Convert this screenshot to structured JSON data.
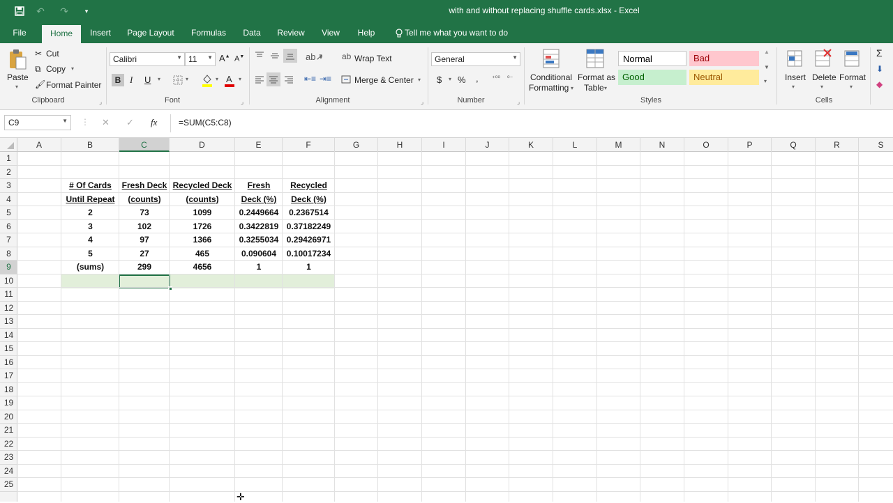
{
  "titlebar": {
    "title": "with and without replacing shuffle cards.xlsx  -  Excel",
    "save_icon": "save-icon",
    "undo_icon": "undo-icon",
    "redo_icon": "redo-icon",
    "customize_icon": "chevron-down-icon"
  },
  "tabs": [
    "File",
    "Home",
    "Insert",
    "Page Layout",
    "Formulas",
    "Data",
    "Review",
    "View",
    "Help"
  ],
  "tell_me": "Tell me what you want to do",
  "ribbon": {
    "clipboard": {
      "paste": "Paste",
      "cut": "Cut",
      "copy": "Copy",
      "format_painter": "Format Painter",
      "label": "Clipboard"
    },
    "font": {
      "name": "Calibri",
      "size": "11",
      "bold": "B",
      "italic": "I",
      "underline": "U",
      "label": "Font"
    },
    "alignment": {
      "wrap": "Wrap Text",
      "merge": "Merge & Center",
      "label": "Alignment"
    },
    "number": {
      "format": "General",
      "dollar": "$",
      "percent": "%",
      "comma": ",",
      "label": "Number"
    },
    "styles": {
      "conditional": "Conditional",
      "conditional2": "Formatting",
      "format_as": "Format as",
      "format_as2": "Table",
      "normal": "Normal",
      "bad": "Bad",
      "good": "Good",
      "neutral": "Neutral",
      "label": "Styles"
    },
    "cells": {
      "insert": "Insert",
      "delete": "Delete",
      "format": "Format",
      "label": "Cells"
    }
  },
  "formula_bar": {
    "name_box": "C9",
    "formula": "=SUM(C5:C8)",
    "cancel": "✕",
    "enter": "✓",
    "fx": "fx"
  },
  "columns": [
    "A",
    "B",
    "C",
    "D",
    "E",
    "F",
    "G",
    "H",
    "I",
    "J",
    "K",
    "L",
    "M",
    "N",
    "O",
    "P",
    "Q",
    "R",
    "S"
  ],
  "rows": [
    "1",
    "2",
    "3",
    "4",
    "5",
    "6",
    "7",
    "8",
    "9",
    "10",
    "11",
    "12",
    "13",
    "14",
    "15",
    "16",
    "17",
    "18",
    "19",
    "20",
    "21",
    "22",
    "23",
    "24",
    "25"
  ],
  "table": {
    "headers_line1": [
      "# Of Cards",
      "Fresh Deck",
      "Recycled Deck",
      "Fresh",
      "Recycled"
    ],
    "headers_line2": [
      "Until Repeat",
      "(counts)",
      "(counts)",
      "Deck (%)",
      "Deck (%)"
    ],
    "rows": [
      [
        "2",
        "73",
        "1099",
        "0.2449664",
        "0.2367514"
      ],
      [
        "3",
        "102",
        "1726",
        "0.3422819",
        "0.37182249"
      ],
      [
        "4",
        "97",
        "1366",
        "0.3255034",
        "0.29426971"
      ],
      [
        "5",
        "27",
        "465",
        "0.090604",
        "0.10017234"
      ],
      [
        "(sums)",
        "299",
        "4656",
        "1",
        "1"
      ]
    ]
  },
  "selected_cell": "C9",
  "colors": {
    "accent": "#217346",
    "sums_row": "#e2efda",
    "bad_fill": "#ffc7ce",
    "good_fill": "#c6efce",
    "neutral_fill": "#ffeb9c"
  }
}
